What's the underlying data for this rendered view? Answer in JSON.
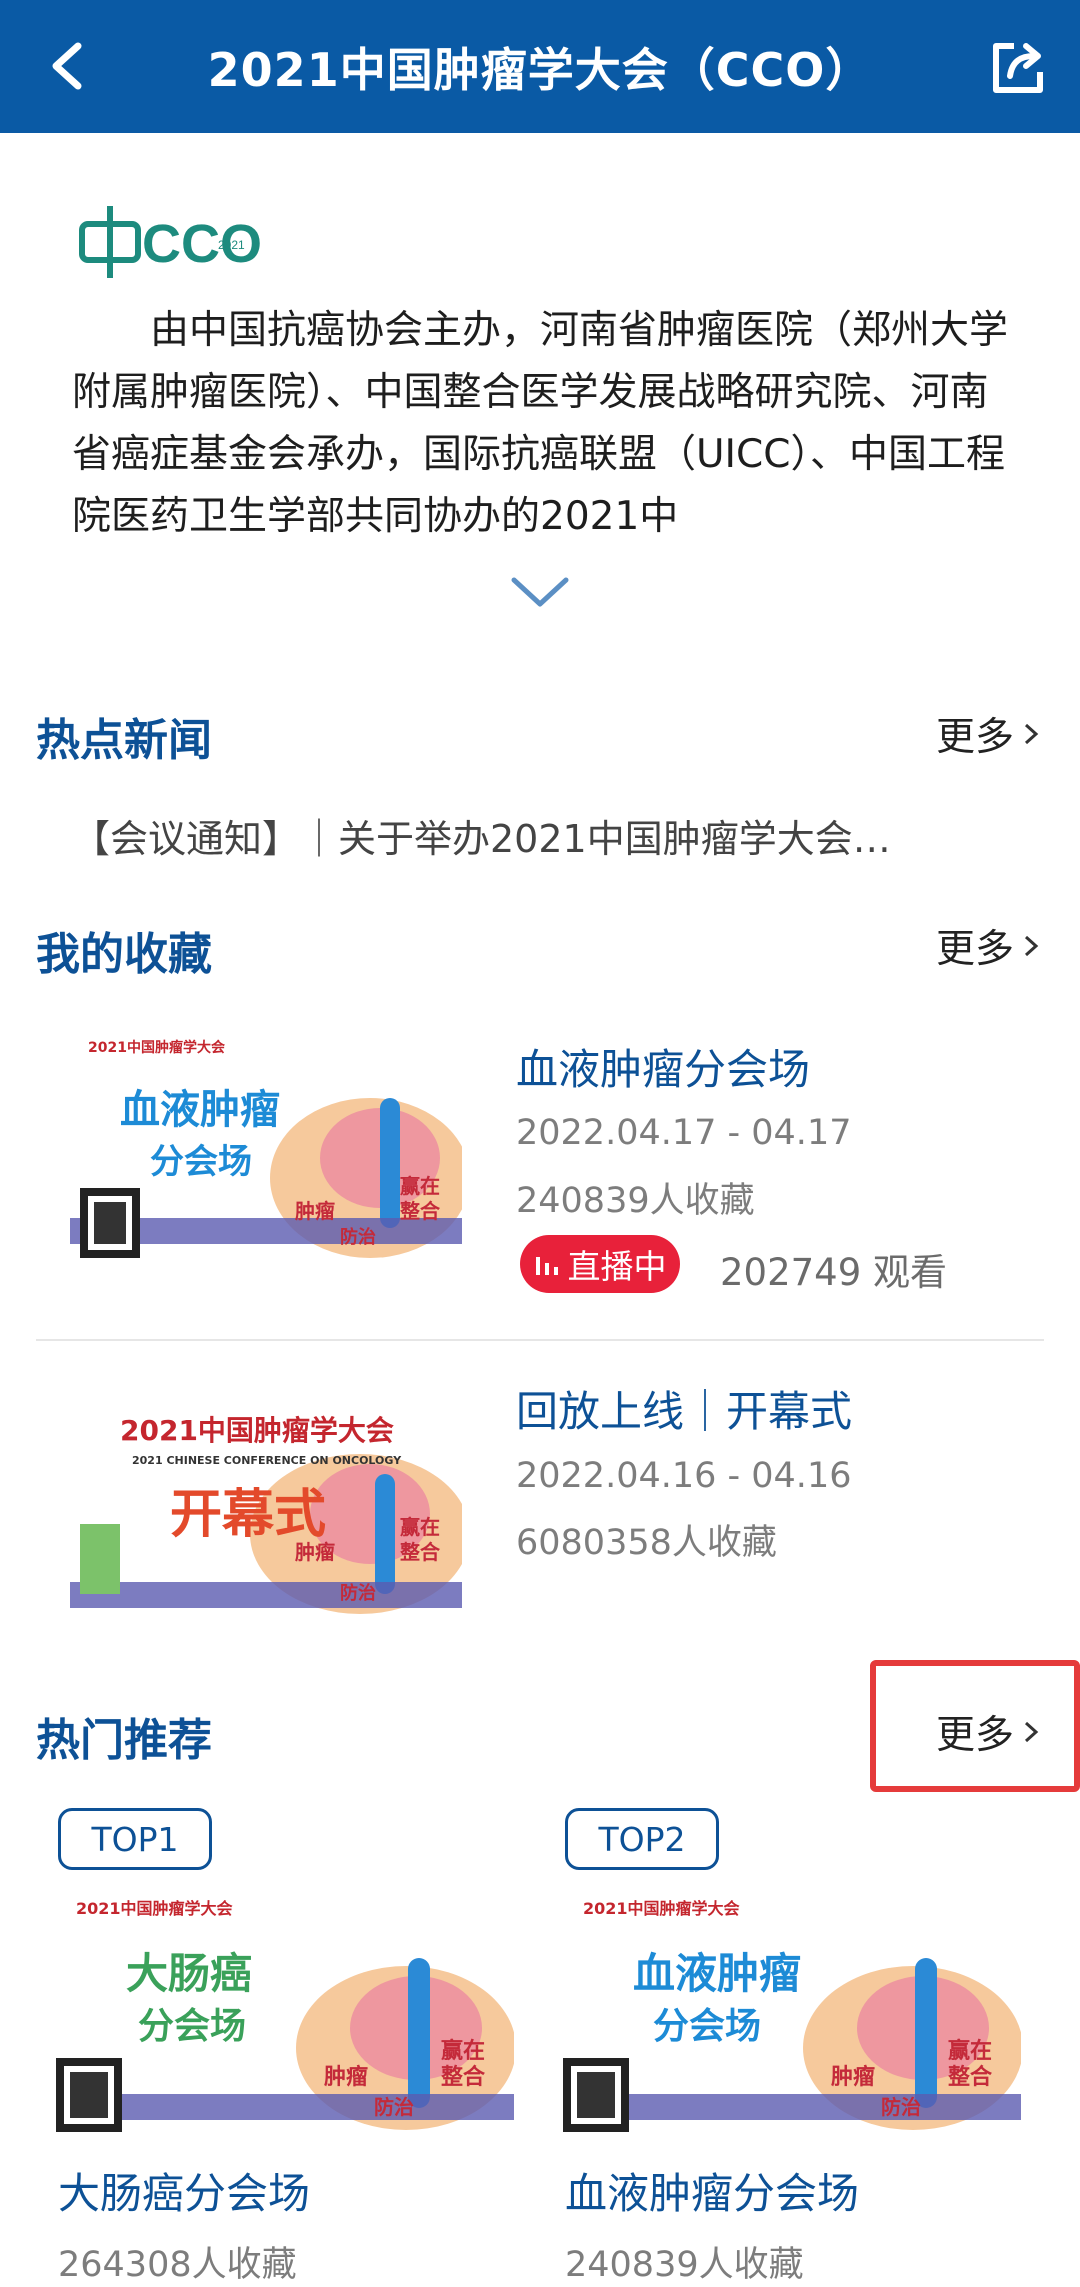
{
  "header": {
    "title": "2021中国肿瘤学大会（CCO）",
    "back_icon": "back-arrow-icon",
    "share_icon": "share-icon",
    "bg_color": "#0a5aa5"
  },
  "logo": {
    "text": "CCO",
    "year": "2021"
  },
  "intro": {
    "text": "由中国抗癌协会主办，河南省肿瘤医院（郑州大学附属肿瘤医院）、中国整合医学发展战略研究院、河南省癌症基金会承办，国际抗癌联盟（UICC）、中国工程院医药卫生学部共同协办的2021中"
  },
  "hot_news": {
    "title": "热点新闻",
    "more": "更多",
    "item": "【会议通知】｜关于举办2021中国肿瘤学大会…"
  },
  "favorites": {
    "title": "我的收藏",
    "more": "更多",
    "items": [
      {
        "poster_main": "血液肿瘤",
        "poster_sub": "分会场",
        "title": "血液肿瘤分会场",
        "date": "2022.04.17 - 04.17",
        "count": "240839人收藏",
        "live_label": "直播中",
        "views": "202749 观看"
      },
      {
        "poster_header": "2021中国肿瘤学大会",
        "poster_sub_en": "2021 CHINESE CONFERENCE ON ONCOLOGY",
        "poster_main": "开幕式",
        "title": "回放上线｜开幕式",
        "date": "2022.04.16 - 04.16",
        "count": "6080358人收藏"
      }
    ]
  },
  "recommend": {
    "title": "热门推荐",
    "more": "更多",
    "items": [
      {
        "tag": "TOP1",
        "poster_main": "大肠癌",
        "poster_sub": "分会场",
        "title": "大肠癌分会场",
        "count": "264308人收藏"
      },
      {
        "tag": "TOP2",
        "poster_main": "血液肿瘤",
        "poster_sub": "分会场",
        "title": "血液肿瘤分会场",
        "count": "240839人收藏"
      }
    ]
  },
  "poster_common": {
    "header": "2021中国肿瘤学大会",
    "tag1": "肿瘤",
    "tag2": "防治",
    "tag3": "赢在",
    "tag4": "整合"
  },
  "colors": {
    "accent": "#0d5196",
    "live": "#e8213a",
    "highlight": "#e53b3b"
  }
}
